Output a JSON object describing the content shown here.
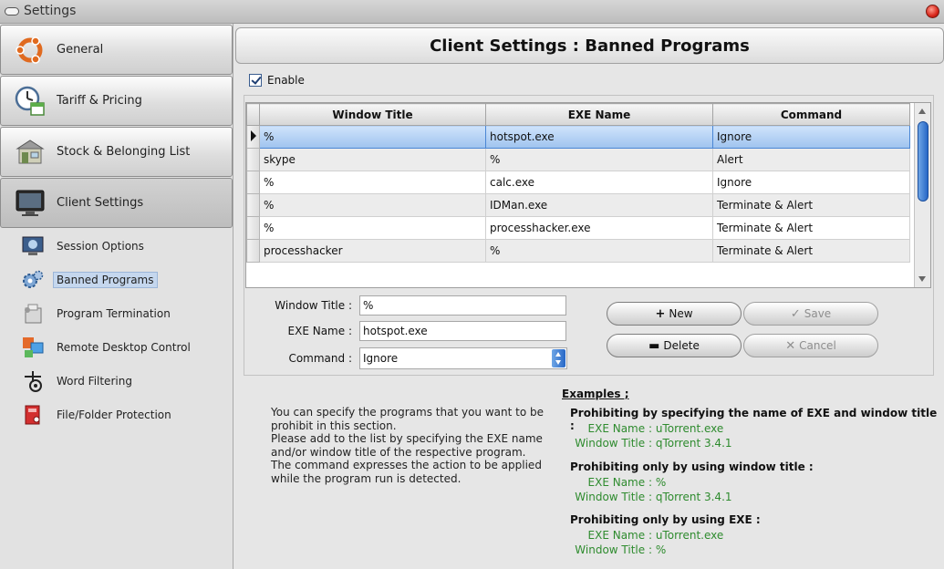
{
  "window": {
    "title": "Settings"
  },
  "sidebar": {
    "main": [
      {
        "label": "General",
        "icon": "ubuntu-logo-icon"
      },
      {
        "label": "Tariff & Pricing",
        "icon": "clock-calendar-icon"
      },
      {
        "label": "Stock & Belonging List",
        "icon": "shop-icon"
      },
      {
        "label": "Client Settings",
        "icon": "monitor-icon"
      }
    ],
    "sub": [
      {
        "label": "Session Options",
        "icon": "session-icon"
      },
      {
        "label": "Banned Programs",
        "icon": "gears-icon"
      },
      {
        "label": "Program Termination",
        "icon": "terminate-icon"
      },
      {
        "label": "Remote Desktop Control",
        "icon": "remote-desktop-icon"
      },
      {
        "label": "Word Filtering",
        "icon": "filter-icon"
      },
      {
        "label": "File/Folder Protection",
        "icon": "folder-lock-icon"
      }
    ]
  },
  "content": {
    "header": "Client Settings : Banned Programs",
    "enable_label": "Enable",
    "grid": {
      "columns": [
        "Window Title",
        "EXE Name",
        "Command"
      ],
      "rows": [
        [
          "%",
          "hotspot.exe",
          "Ignore"
        ],
        [
          "skype",
          "%",
          "Alert"
        ],
        [
          "%",
          "calc.exe",
          "Ignore"
        ],
        [
          "%",
          "IDMan.exe",
          "Terminate & Alert"
        ],
        [
          "%",
          "processhacker.exe",
          "Terminate & Alert"
        ],
        [
          "processhacker",
          "%",
          "Terminate & Alert"
        ]
      ],
      "selected_row": 0
    },
    "form": {
      "window_title_label": "Window Title :",
      "window_title_value": "%",
      "exe_name_label": "EXE Name :",
      "exe_name_value": "hotspot.exe",
      "command_label": "Command :",
      "command_value": "Ignore"
    },
    "buttons": {
      "new": "New",
      "save": "Save",
      "delete": "Delete",
      "cancel": "Cancel"
    },
    "description": "You can specify the programs that you want to be prohibit in this section.\nPlease add to the list by specifying the EXE name and/or window title of the respective program. The command expresses the action to be applied while the program run is detected.",
    "examples": {
      "title": "Examples ;",
      "items": [
        {
          "heading": "Prohibiting by specifying the name of EXE and window title :",
          "exe_label": "EXE Name :",
          "exe_value": "uTorrent.exe",
          "win_label": "Window Title :",
          "win_value": "qTorrent 3.4.1"
        },
        {
          "heading": "Prohibiting only by using window title :",
          "exe_label": "EXE Name :",
          "exe_value": "%",
          "win_label": "Window Title :",
          "win_value": "qTorrent 3.4.1"
        },
        {
          "heading": "Prohibiting only by using EXE :",
          "exe_label": "EXE Name :",
          "exe_value": "uTorrent.exe",
          "win_label": "Window Title :",
          "win_value": "%"
        }
      ]
    }
  },
  "colors": {
    "accent": "#2767c6",
    "example_text": "#2e8b2e",
    "selection": "#9fc3ee"
  }
}
